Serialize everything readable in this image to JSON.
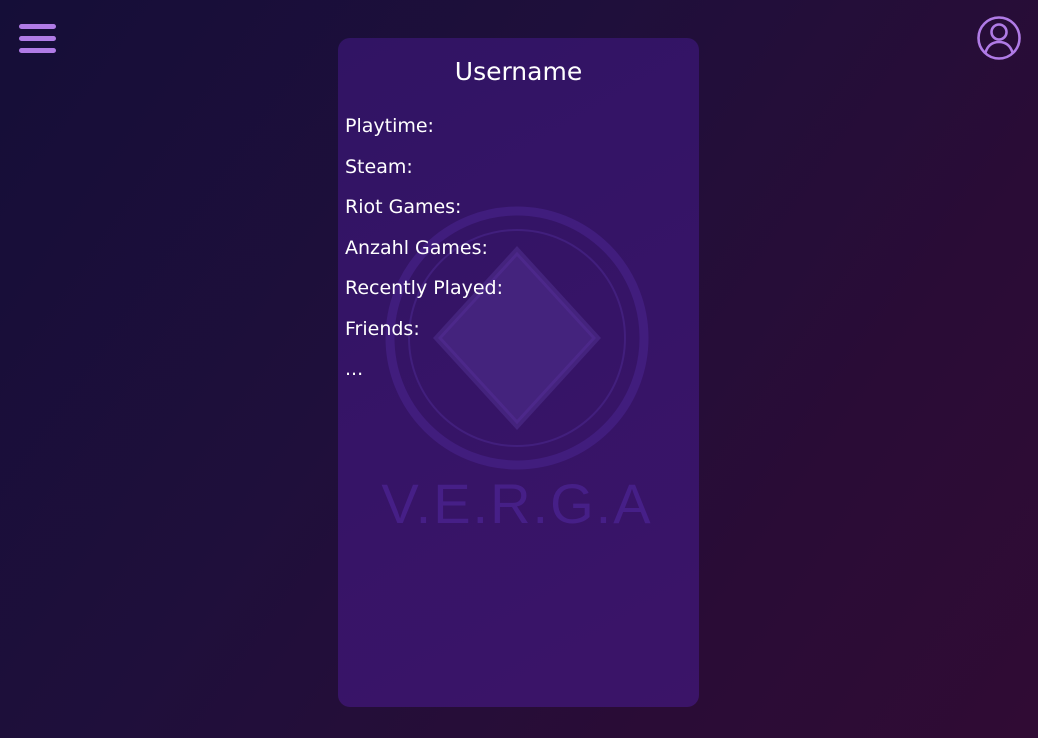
{
  "header": {
    "menu_icon": "hamburger-menu-icon",
    "profile_icon": "user-circle-icon"
  },
  "profile_card": {
    "title": "Username",
    "fields": [
      "Playtime:",
      "Steam:",
      "Riot Games:",
      "Anzahl Games:",
      "Recently Played:",
      "Friends:",
      "..."
    ],
    "watermark": {
      "logo_icon": "diamond-in-ring-logo",
      "text": "V.E.R.G.A"
    }
  },
  "colors": {
    "background_start": "#150e38",
    "background_end": "#300b34",
    "card_background": "#361467",
    "accent": "#b07be6",
    "text": "#ffffff"
  }
}
